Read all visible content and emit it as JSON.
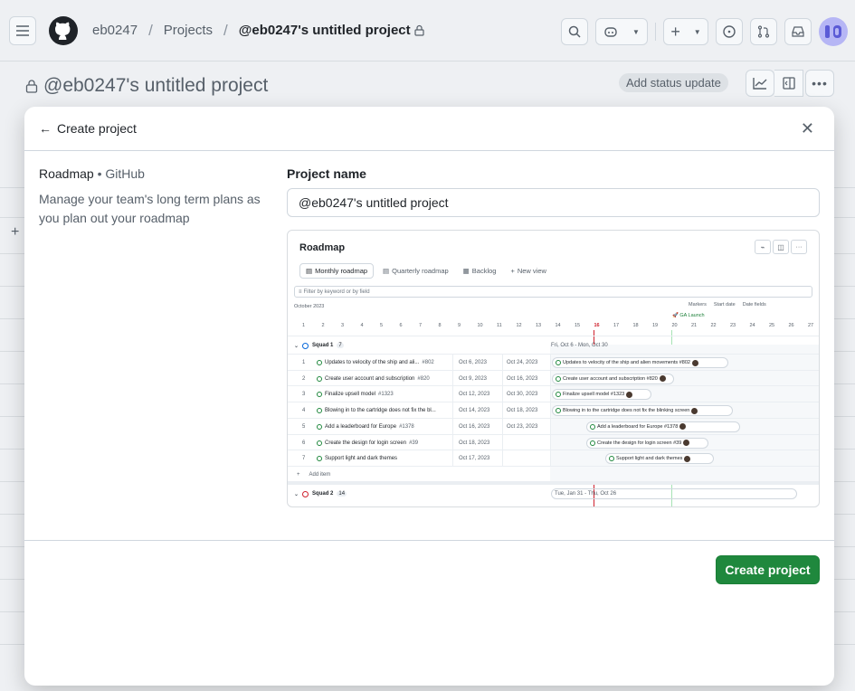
{
  "header": {
    "owner": "eb0247",
    "projects": "Projects",
    "current": "@eb0247's untitled project",
    "menu_icon": "hamburger-icon",
    "logo_icon": "github-logo-icon"
  },
  "subheader": {
    "title": "@eb0247's untitled project",
    "status_button": "Add status update"
  },
  "modal": {
    "back_label": "Create project",
    "template_name": "Roadmap",
    "template_source": " • GitHub",
    "template_desc": "Manage your team's long term plans as you plan out your roadmap",
    "field_label": "Project name",
    "field_value": "@eb0247's untitled project",
    "create_button": "Create project"
  },
  "preview": {
    "title": "Roadmap",
    "tabs": [
      "Monthly roadmap",
      "Quarterly roadmap",
      "Backlog",
      "New view"
    ],
    "filter_placeholder": "Filter by keyword or by field",
    "month": "October 2023",
    "controls": [
      "Markers",
      "Start date",
      "Date fields"
    ],
    "launch": "GA Launch",
    "days": [
      "1",
      "2",
      "3",
      "4",
      "5",
      "6",
      "7",
      "8",
      "9",
      "10",
      "11",
      "12",
      "13",
      "14",
      "15",
      "16",
      "17",
      "18",
      "19",
      "20",
      "21",
      "22",
      "23",
      "24",
      "25",
      "26",
      "27"
    ],
    "group1": {
      "name": "Squad 1",
      "count": "7",
      "range": "Fri, Oct 6 - Mon, Oct 30"
    },
    "rows": [
      {
        "n": "1",
        "title": "Updates to velocity of the ship and ali...",
        "num": "#802",
        "start": "Oct 6, 2023",
        "end": "Oct 24, 2023",
        "bar": "Updates to velocity of the ship and alien movements #802"
      },
      {
        "n": "2",
        "title": "Create user account and subscription",
        "num": "#820",
        "start": "Oct 9, 2023",
        "end": "Oct 16, 2023",
        "bar": "Create user account and subscription #820"
      },
      {
        "n": "3",
        "title": "Finalize upsell model",
        "num": "#1323",
        "start": "Oct 12, 2023",
        "end": "Oct 30, 2023",
        "bar": "Finalize upsell model #1323"
      },
      {
        "n": "4",
        "title": "Blowing in to the cartridge does not fix the bl...",
        "num": "",
        "start": "Oct 14, 2023",
        "end": "Oct 18, 2023",
        "bar": "Blowing in to the cartridge does not fix the blinking screen"
      },
      {
        "n": "5",
        "title": "Add a leaderboard for Europe",
        "num": "#1378",
        "start": "Oct 16, 2023",
        "end": "Oct 23, 2023",
        "bar": "Add a leaderboard for Europe #1378"
      },
      {
        "n": "6",
        "title": "Create the design for login screen",
        "num": "#39",
        "start": "Oct 18, 2023",
        "end": "",
        "bar": "Create the design for login screen #39"
      },
      {
        "n": "7",
        "title": "Support light and dark themes",
        "num": "",
        "start": "Oct 17, 2023",
        "end": "",
        "bar": "Support light and dark themes"
      }
    ],
    "add_item": "Add item",
    "group2": {
      "name": "Squad 2",
      "count": "14",
      "range": "Tue, Jan 31 - Thu, Oct 26"
    }
  }
}
